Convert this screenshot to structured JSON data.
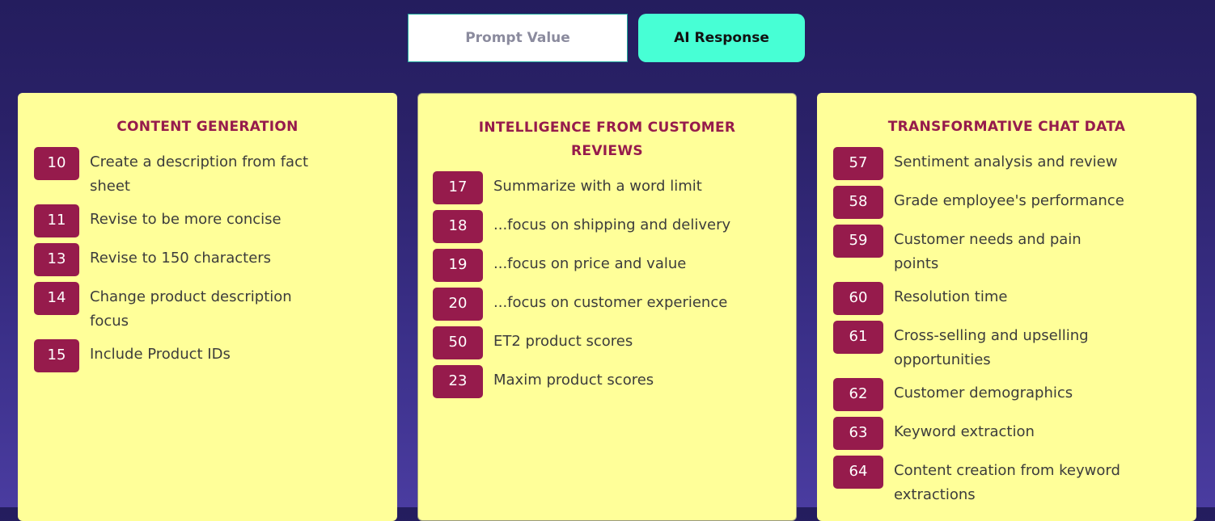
{
  "toggle": {
    "prompt_label": "Prompt Value",
    "ai_label": "AI Response",
    "active": "AI Response"
  },
  "colors": {
    "accent_teal": "#47ffd5",
    "badge": "#961b4c",
    "card_bg": "#ffff99",
    "title": "#961b4c"
  },
  "columns": [
    {
      "title": "CONTENT GENERATION",
      "items": [
        {
          "num": "10",
          "text": "Create a description from fact sheet"
        },
        {
          "num": "11",
          "text": "Revise to be more concise"
        },
        {
          "num": "13",
          "text": "Revise to 150 characters"
        },
        {
          "num": "14",
          "text": "Change product description focus"
        },
        {
          "num": "15",
          "text": "Include Product IDs"
        }
      ]
    },
    {
      "title": "INTELLIGENCE FROM CUSTOMER REVIEWS",
      "items": [
        {
          "num": "17",
          "text": "Summarize with a word limit"
        },
        {
          "num": "18",
          "text": "...focus on shipping and delivery"
        },
        {
          "num": "19",
          "text": "...focus on price and value"
        },
        {
          "num": "20",
          "text": "...focus on customer experience"
        },
        {
          "num": "50",
          "text": "ET2 product scores"
        },
        {
          "num": "23",
          "text": "Maxim product scores"
        }
      ]
    },
    {
      "title": "TRANSFORMATIVE CHAT DATA",
      "items": [
        {
          "num": "57",
          "text": "Sentiment analysis and review"
        },
        {
          "num": "58",
          "text": "Grade employee's performance"
        },
        {
          "num": "59",
          "text": "Customer needs and pain points"
        },
        {
          "num": "60",
          "text": "Resolution time"
        },
        {
          "num": "61",
          "text": "Cross-selling and upselling opportunities"
        },
        {
          "num": "62",
          "text": "Customer demographics"
        },
        {
          "num": "63",
          "text": "Keyword extraction"
        },
        {
          "num": "64",
          "text": "Content creation from keyword extractions"
        }
      ]
    }
  ]
}
